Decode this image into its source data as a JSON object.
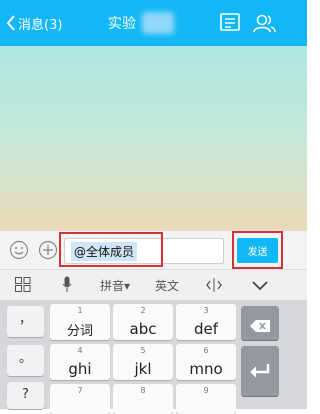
{
  "header": {
    "back_label": "消息(3)",
    "title": "实验",
    "bg_color": "#12b7f5"
  },
  "input_bar": {
    "input_value": "@全体成员",
    "send_label": "发送",
    "accent": "#12b7f5",
    "highlight_color": "#d4323a"
  },
  "keyboard_toolbar": {
    "pinyin_label": "拼音",
    "english_label": "英文"
  },
  "keyboard": {
    "side_keys": [
      "，",
      "。",
      "?"
    ],
    "rows": [
      [
        {
          "num": "1",
          "label": "分词"
        },
        {
          "num": "2",
          "label": "abc"
        },
        {
          "num": "3",
          "label": "def"
        }
      ],
      [
        {
          "num": "4",
          "label": "ghi"
        },
        {
          "num": "5",
          "label": "jkl"
        },
        {
          "num": "6",
          "label": "mno"
        }
      ],
      [
        {
          "num": "7",
          "label": ""
        },
        {
          "num": "8",
          "label": ""
        },
        {
          "num": "9",
          "label": ""
        }
      ]
    ]
  }
}
